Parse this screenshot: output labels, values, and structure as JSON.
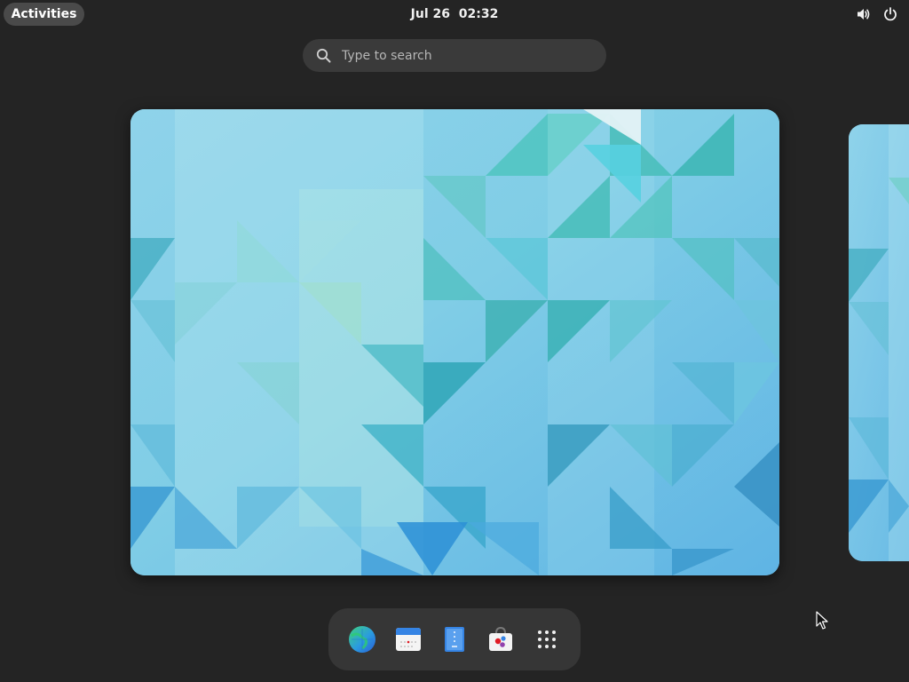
{
  "topbar": {
    "activities_label": "Activities",
    "clock_date": "Jul 26",
    "clock_time": "02:32",
    "status_icons": [
      "volume-icon",
      "power-icon"
    ]
  },
  "search": {
    "placeholder": "Type to search"
  },
  "workspaces": {
    "count_visible": 2,
    "active_index": 0
  },
  "dash": {
    "items": [
      {
        "name": "web-browser-icon"
      },
      {
        "name": "calendar-icon"
      },
      {
        "name": "text-editor-icon"
      },
      {
        "name": "software-center-icon"
      },
      {
        "name": "show-apps-icon"
      }
    ]
  },
  "colors": {
    "panel_bg": "#242424",
    "activities_bg": "#4a4a4a",
    "search_bg": "#3a3a3a",
    "dash_bg": "#363636",
    "wallpaper_light": "#a9dff0",
    "wallpaper_teal": "#45bfb7",
    "wallpaper_blue": "#3a8fd8"
  }
}
